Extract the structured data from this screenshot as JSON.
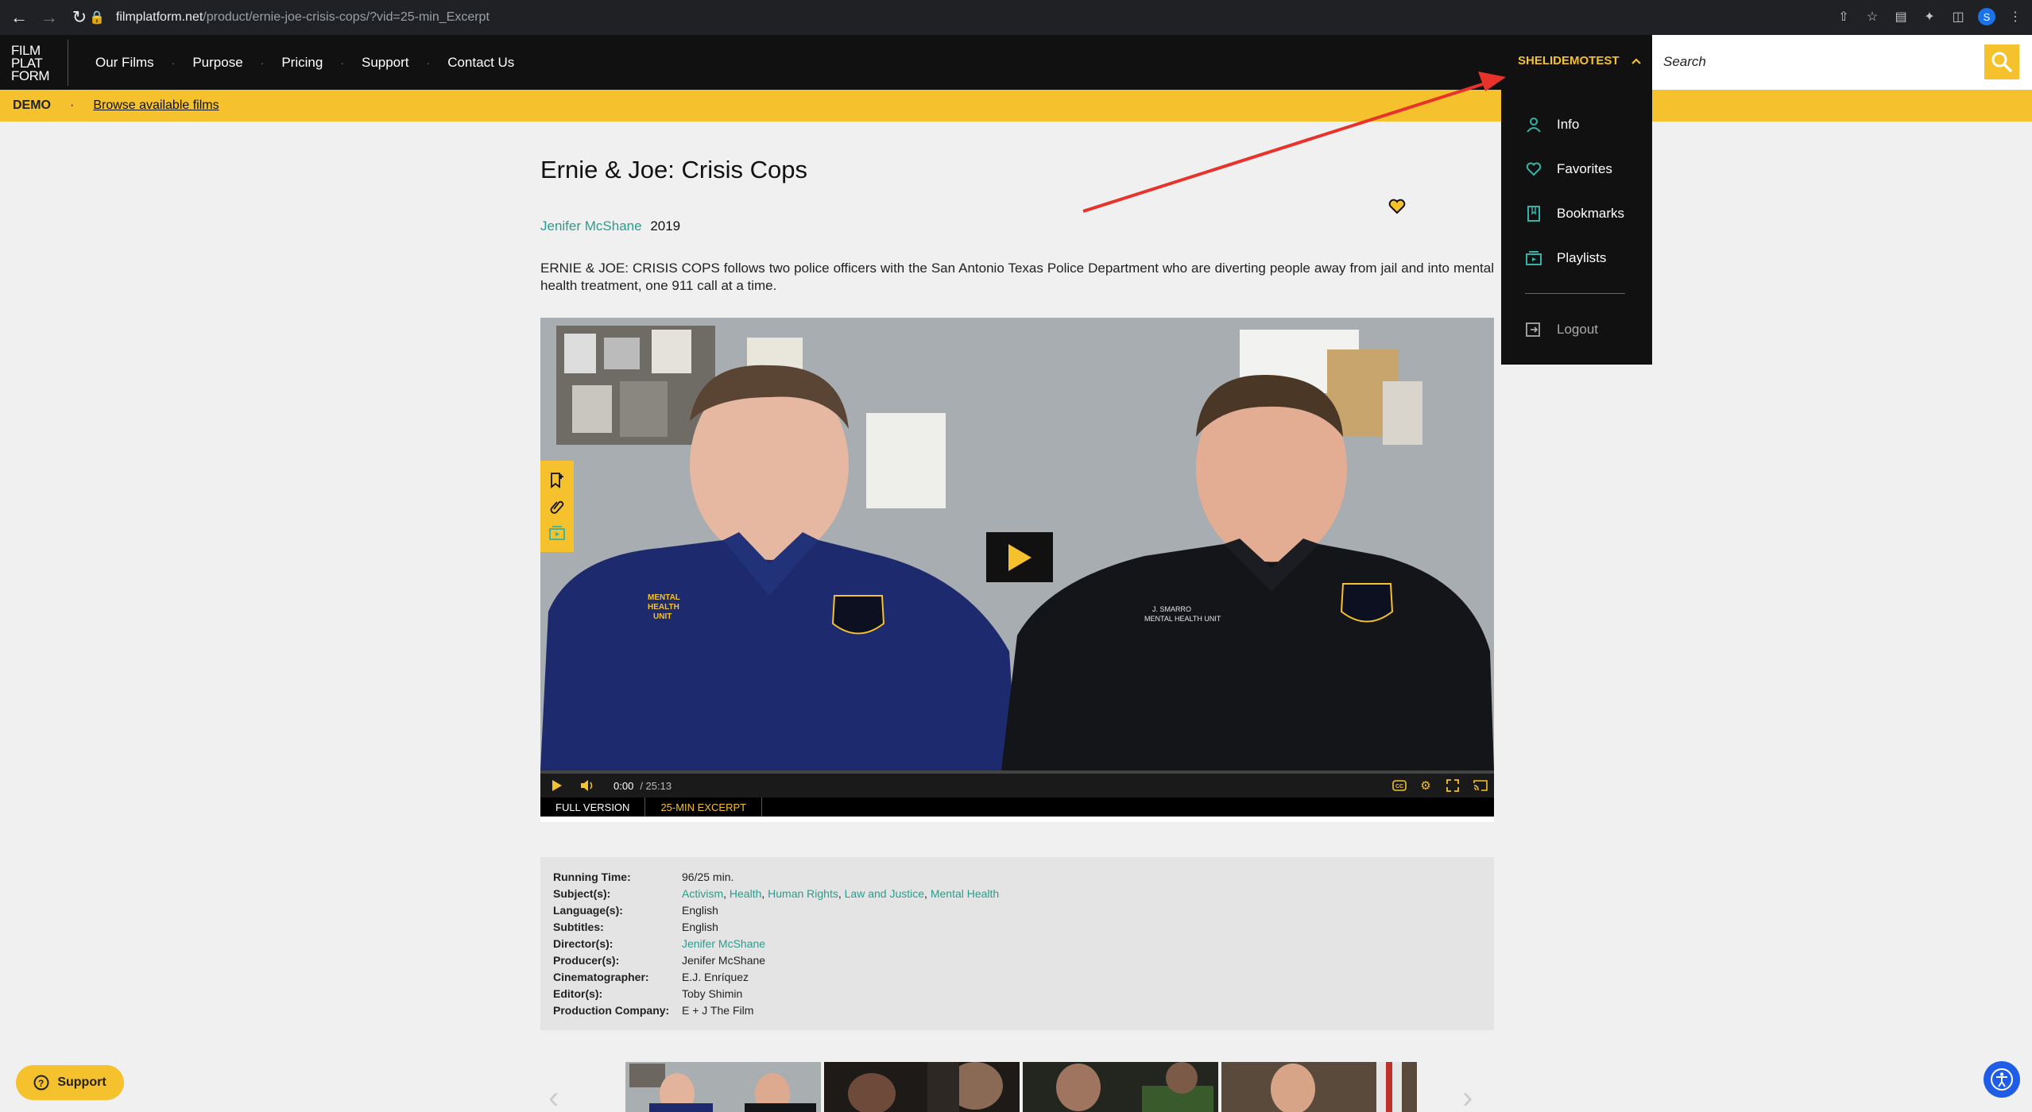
{
  "browser": {
    "url_domain": "filmplatform.net",
    "url_path": "/product/ernie-joe-crisis-cops/?vid=25-min_Excerpt",
    "profile_initial": "S"
  },
  "header": {
    "logo_lines": [
      "FILM",
      "PLAT",
      "FORM"
    ],
    "nav": [
      "Our Films",
      "Purpose",
      "Pricing",
      "Support",
      "Contact Us"
    ],
    "account_name": "SHELIDEMOTEST",
    "search_placeholder": "Search"
  },
  "demo_bar": {
    "label": "DEMO",
    "separator": "·",
    "link": "Browse available films"
  },
  "account_menu": {
    "items": [
      {
        "label": "Info",
        "icon": "person-icon"
      },
      {
        "label": "Favorites",
        "icon": "heart-icon"
      },
      {
        "label": "Bookmarks",
        "icon": "bookmark-icon"
      },
      {
        "label": "Playlists",
        "icon": "playlist-icon"
      }
    ],
    "logout": "Logout"
  },
  "film": {
    "title": "Ernie & Joe: Crisis Cops",
    "director": "Jenifer McShane",
    "year": "2019",
    "synopsis": "ERNIE & JOE: CRISIS COPS follows two police officers with the San Antonio Texas Police Department who are diverting people away from jail and into mental health treatment, one 911 call at a time."
  },
  "player": {
    "time_current": "0:00",
    "time_duration": "/ 25:13",
    "progress": 0,
    "tabs": [
      "FULL VERSION",
      "25-MIN EXCERPT"
    ],
    "active_tab": "25-MIN EXCERPT",
    "left_badge_text": "MENTAL HEALTH UNIT",
    "right_badge_text": "J. SMARRO MENTAL HEALTH UNIT"
  },
  "details": {
    "running_time": {
      "label": "Running Time:",
      "value": "96/25 min."
    },
    "subjects": {
      "label": "Subject(s):",
      "values": [
        "Activism",
        "Health",
        "Human Rights",
        "Law and Justice",
        "Mental Health"
      ]
    },
    "languages": {
      "label": "Language(s):",
      "value": "English"
    },
    "subtitles": {
      "label": "Subtitles:",
      "value": "English"
    },
    "directors": {
      "label": "Director(s):",
      "value": "Jenifer McShane"
    },
    "producers": {
      "label": "Producer(s):",
      "value": "Jenifer McShane"
    },
    "cinematographer": {
      "label": "Cinematographer:",
      "value": "E.J. Enríquez"
    },
    "editors": {
      "label": "Editor(s):",
      "value": "Toby Shimin"
    },
    "production_company": {
      "label": "Production Company:",
      "value": "E + J The Film"
    }
  },
  "floating": {
    "support_label": "Support"
  },
  "colors": {
    "accent_yellow": "#f5c12d",
    "teal_link": "#2a9d8f",
    "header_black": "#111111",
    "annotation_red": "#e8332a"
  }
}
